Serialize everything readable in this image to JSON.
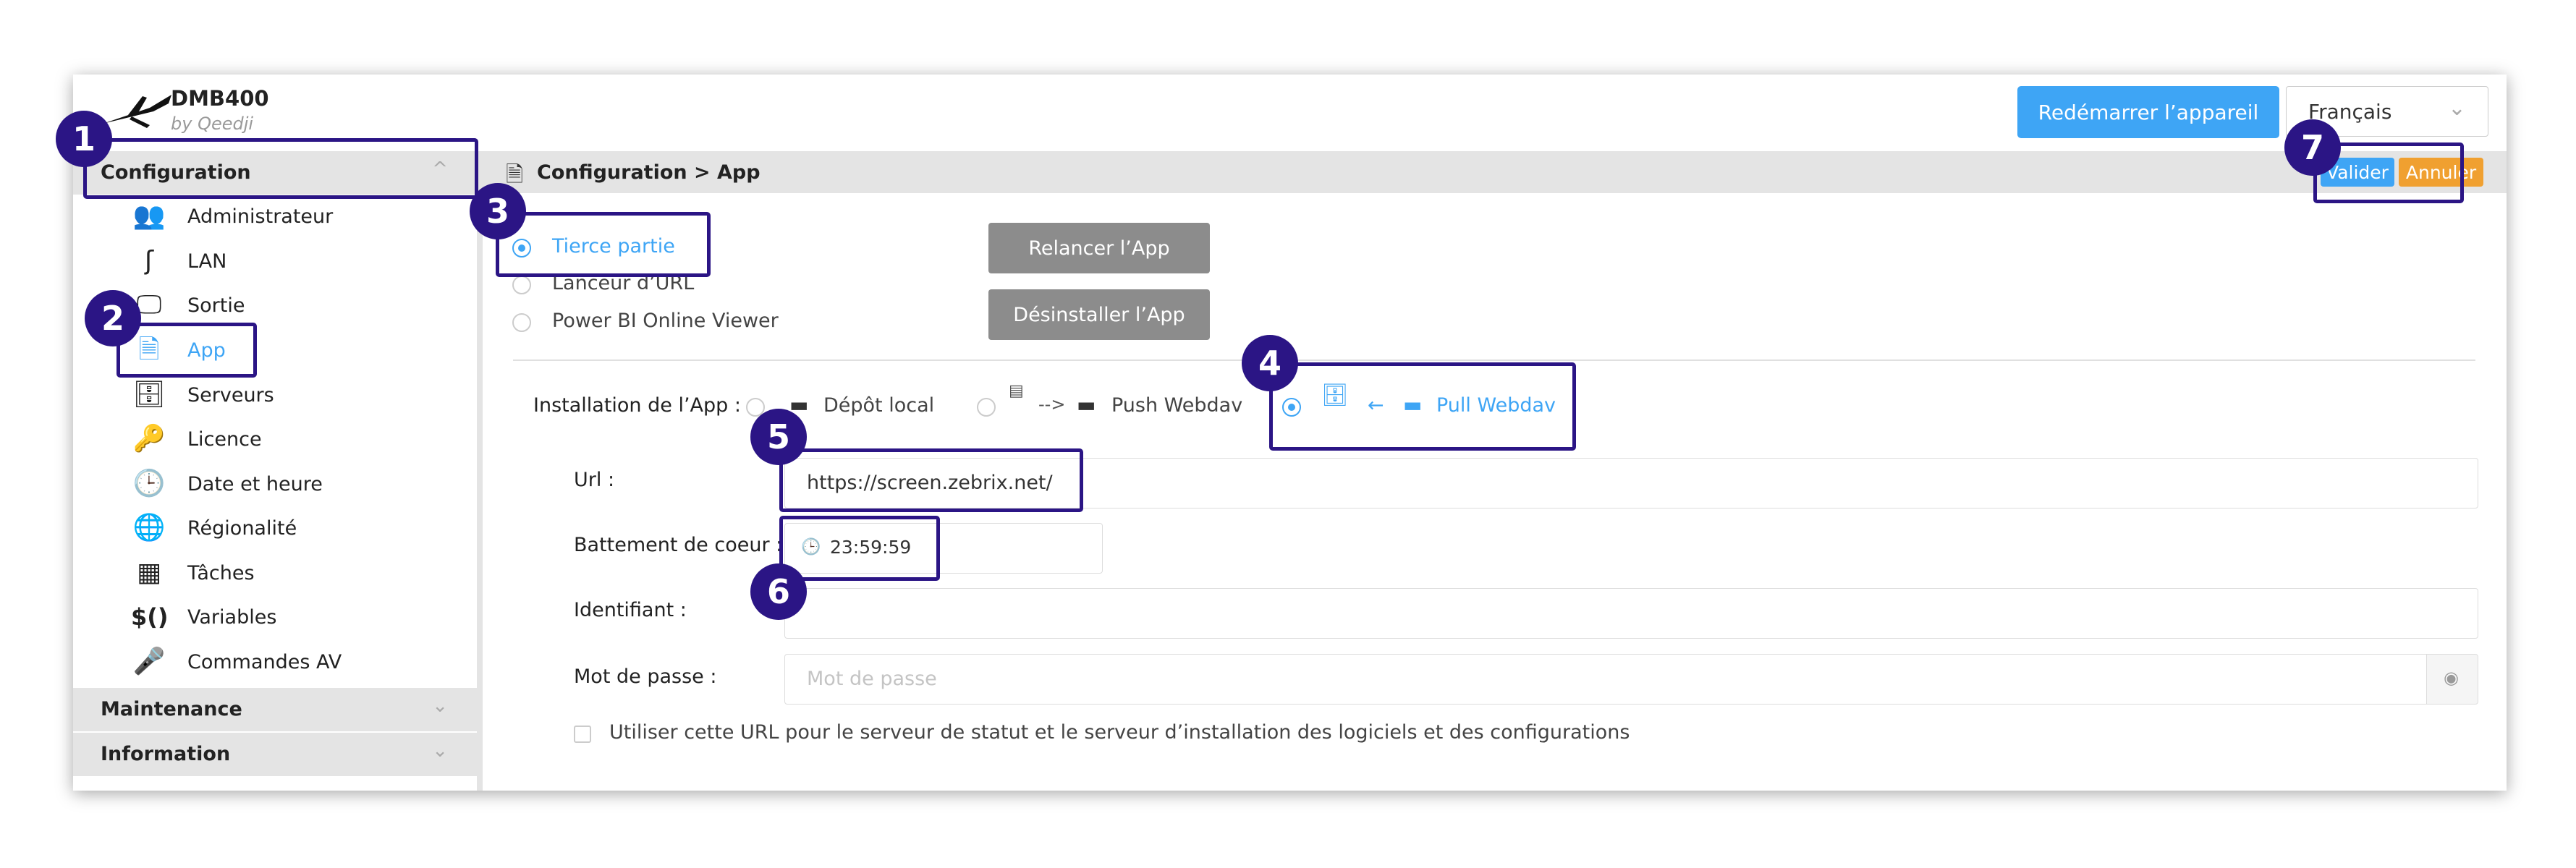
{
  "header": {
    "brand_name": "DMB400",
    "brand_sub": "by Qeedji",
    "restart_label": "Redémarrer l’appareil",
    "language_value": "Français",
    "chevron_glyph": "⌄"
  },
  "sidebar": {
    "sections": [
      {
        "label": "Configuration",
        "expanded": true,
        "chevron": "^"
      },
      {
        "label": "Maintenance",
        "expanded": false,
        "chevron": "⌄"
      },
      {
        "label": "Information",
        "expanded": false,
        "chevron": "⌄"
      }
    ],
    "items": [
      {
        "label": "Administrateur",
        "icon": "users-gear-icon",
        "glyph": "👥"
      },
      {
        "label": "LAN",
        "icon": "cable-icon",
        "glyph": "ʃ"
      },
      {
        "label": "Sortie",
        "icon": "monitor-icon",
        "glyph": "🖵"
      },
      {
        "label": "App",
        "icon": "html5-icon",
        "glyph": "🗎",
        "active": true
      },
      {
        "label": "Serveurs",
        "icon": "server-icon",
        "glyph": "🗄"
      },
      {
        "label": "Licence",
        "icon": "key-icon",
        "glyph": "🔑"
      },
      {
        "label": "Date et heure",
        "icon": "clock-icon",
        "glyph": "🕒"
      },
      {
        "label": "Régionalité",
        "icon": "globe-icon",
        "glyph": "🌐"
      },
      {
        "label": "Tâches",
        "icon": "calendar-icon",
        "glyph": "▦"
      },
      {
        "label": "Variables",
        "icon": "dollar-variable-icon",
        "glyph": "$()"
      },
      {
        "label": "Commandes AV",
        "icon": "microphone-icon",
        "glyph": "🎤"
      }
    ]
  },
  "content": {
    "breadcrumb": "Configuration > App",
    "breadcrumb_icon": "html5-icon",
    "validate_label": "Valider",
    "cancel_label": "Annuler",
    "app_types": [
      {
        "label": "Tierce partie",
        "selected": true
      },
      {
        "label": "Lanceur d’URL",
        "selected": false
      },
      {
        "label": "Power BI Online Viewer",
        "selected": false
      }
    ],
    "relaunch_label": "Relancer l’App",
    "uninstall_label": "Désinstaller l’App",
    "install_label": "Installation de l’App :",
    "install_options": [
      {
        "label": "Dépôt local",
        "selected": false
      },
      {
        "label": "Push Webdav",
        "selected": false
      },
      {
        "label": "Pull Webdav",
        "selected": true
      }
    ],
    "push_arrow": "-->",
    "pull_arrow": "←",
    "url_label": "Url :",
    "url_value": "https://screen.zebrix.net/",
    "heartbeat_label": "Battement de coeur :",
    "heartbeat_value": "23:59:59",
    "identifier_label": "Identifiant :",
    "identifier_value": "",
    "password_label": "Mot de passe :",
    "password_placeholder": "Mot de passe",
    "checkbox_label": "Utiliser cette URL pour le serveur de statut et le serveur d’installation des logiciels et des configurations",
    "checkbox_checked": false
  },
  "annotations": [
    "1",
    "2",
    "3",
    "4",
    "5",
    "6",
    "7"
  ],
  "colors": {
    "accent": "#3ea5f5",
    "annotation": "#2b1585",
    "cancel": "#f0a030",
    "grey_button": "#8c8c8c"
  }
}
